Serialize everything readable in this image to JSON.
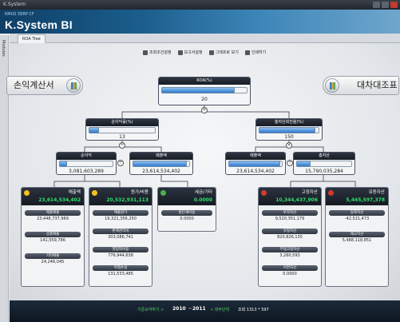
{
  "window": {
    "title": "K.System"
  },
  "header": {
    "subtitle": "KMUS 5ERP CF",
    "brand": "K.System BI"
  },
  "sidetab": {
    "label": "Modules"
  },
  "tab": {
    "label": "ROA Tree"
  },
  "toolbar": [
    {
      "label": "조회조건설정",
      "icon": "filter-icon"
    },
    {
      "label": "보고서설정",
      "icon": "settings-icon"
    },
    {
      "label": "그래프로 보기",
      "icon": "chart-icon"
    },
    {
      "label": "인쇄하기",
      "icon": "print-icon"
    }
  ],
  "side_buttons": {
    "left": "손익계산서",
    "right": "대차대조표"
  },
  "root": {
    "title": "ROA(%)",
    "value": "20",
    "fill": 0.85
  },
  "level2": [
    {
      "title": "순이익률(%)",
      "value": "13",
      "fill": 0.15
    },
    {
      "title": "총자산회전율(%)",
      "value": "150",
      "fill": 0.93
    }
  ],
  "level3": [
    {
      "title": "순이익",
      "value": "3,081,603,289",
      "fill": 0.15
    },
    {
      "title": "매출액",
      "value": "23,614,534,402",
      "fill": 0.95
    },
    {
      "title": "매출액",
      "value": "23,614,534,402",
      "fill": 0.95
    },
    {
      "title": "총자산",
      "value": "15,790,035,284",
      "fill": 0.25
    }
  ],
  "groups": [
    {
      "title": "매출액",
      "value": "23,614,534,402",
      "dot": "#f3c21a",
      "items": [
        {
          "label": "제품매출",
          "value": "23,448,737,969"
        },
        {
          "label": "상품매출",
          "value": "141,559,786"
        },
        {
          "label": "기타매출",
          "value": "24,246,045"
        }
      ]
    },
    {
      "title": "원가/비용",
      "value": "20,532,931,113",
      "dot": "#f3c21a",
      "items": [
        {
          "label": "매출원가",
          "value": "19,321,356,250"
        },
        {
          "label": "판매관리비",
          "value": "303,086,741"
        },
        {
          "label": "영업외비용",
          "value": "776,944,638"
        },
        {
          "label": "특별손실",
          "value": "131,533,485"
        }
      ]
    },
    {
      "title": "세금/기타",
      "value": "0.0000",
      "dot": "#4ab04a",
      "items": [
        {
          "label": "법인세비용",
          "value": "0.0000"
        }
      ]
    },
    {
      "title": "고정자산",
      "value": "10,344,437,906",
      "dot": "#d23a2a",
      "items": [
        {
          "label": "투자자산",
          "value": "9,520,351,179"
        },
        {
          "label": "유형자산",
          "value": "820,826,135"
        },
        {
          "label": "무형고정자산",
          "value": "3,260,593"
        },
        {
          "label": "이연자산",
          "value": "0.0000"
        }
      ]
    },
    {
      "title": "유동자산",
      "value": "5,445,597,378",
      "dot": "#d23a2a",
      "items": [
        {
          "label": "당좌자산",
          "value": "-42,521,473"
        },
        {
          "label": "재고자산",
          "value": "5,488,118,851"
        }
      ]
    }
  ],
  "status": {
    "prev": "기준요약하기 >",
    "year_from": "2010",
    "year_to": "2011",
    "next": "< 대주단위",
    "count": "조회 1313 * 597"
  }
}
